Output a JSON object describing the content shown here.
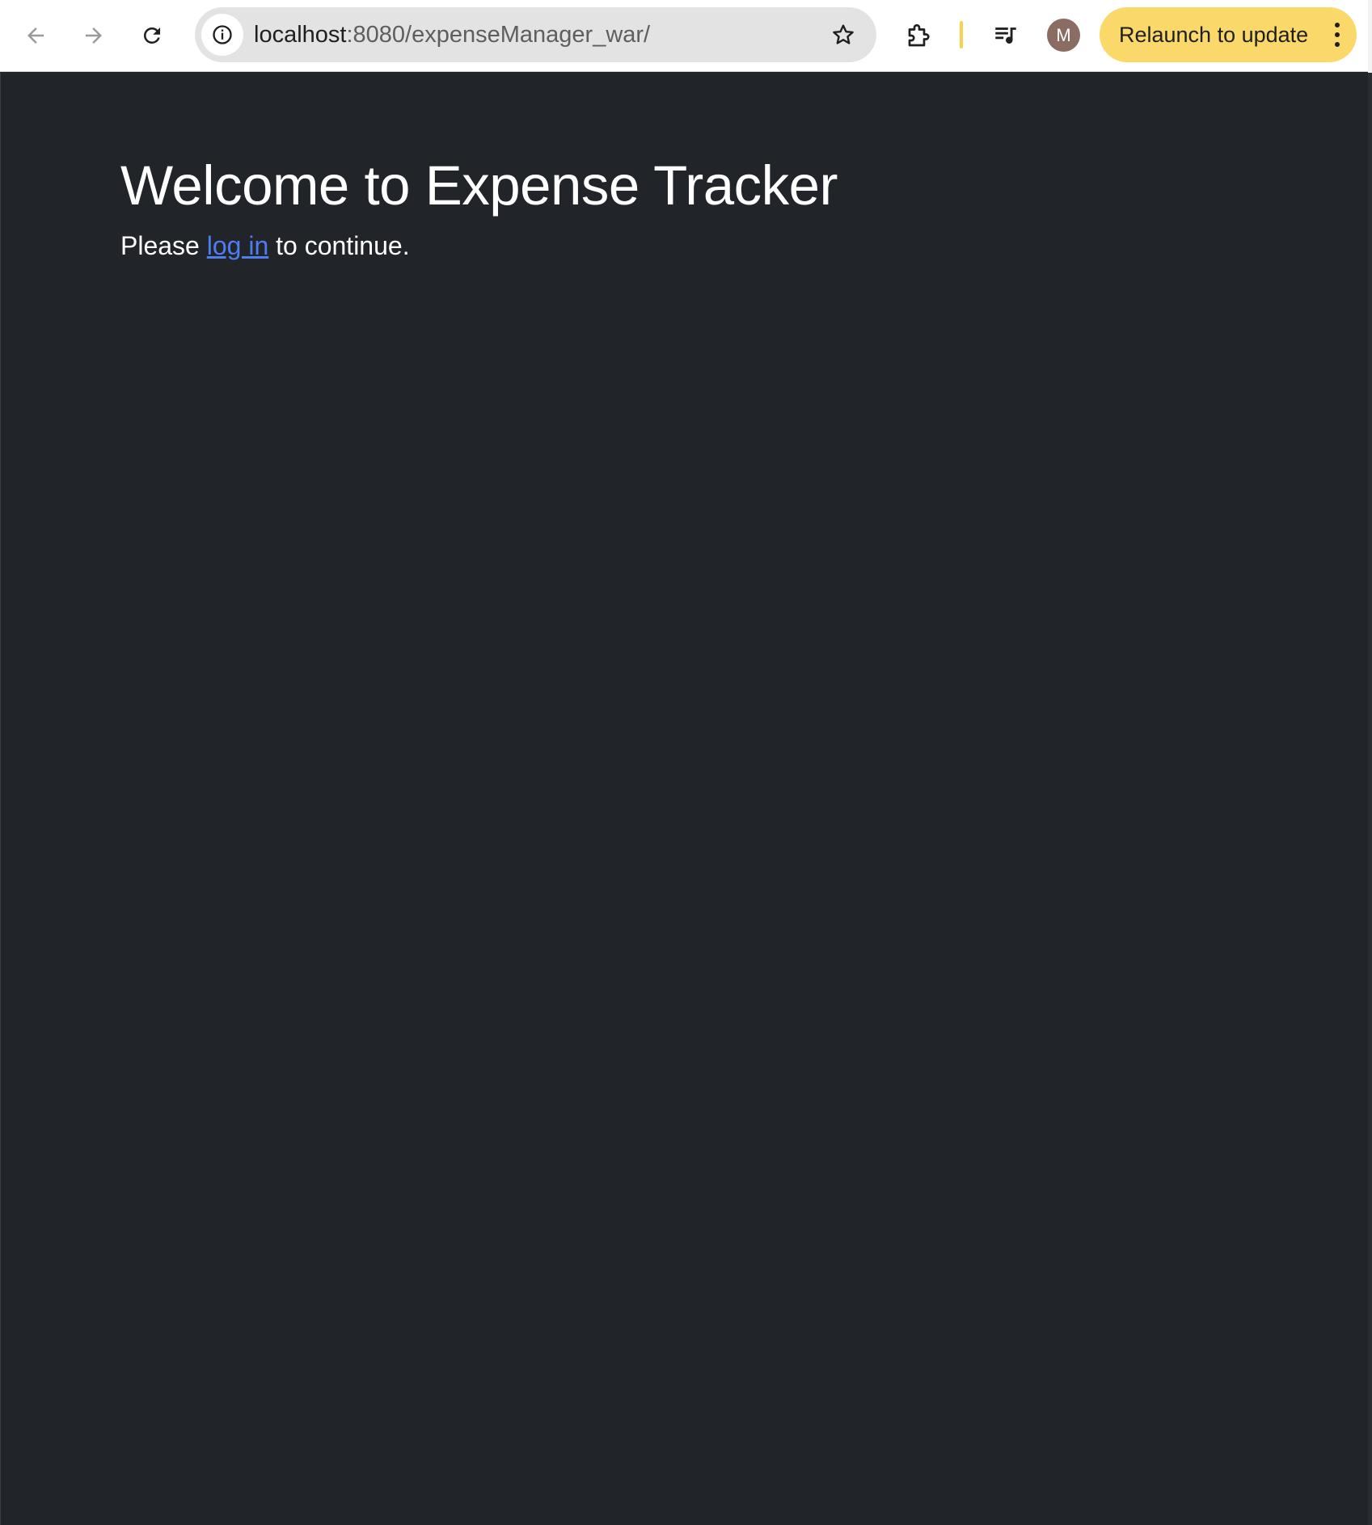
{
  "browser": {
    "url_host": "localhost",
    "url_path": ":8080/expenseManager_war/",
    "avatar_initial": "M",
    "relaunch_label": "Relaunch to update",
    "icons": {
      "back": "arrow-left-icon",
      "forward": "arrow-right-icon",
      "reload": "reload-icon",
      "site_info": "info-icon",
      "bookmark": "star-icon",
      "extensions": "puzzle-icon",
      "media": "media-queue-icon",
      "menu": "kebab-menu-icon"
    },
    "colors": {
      "relaunch_bg": "#fad96a",
      "avatar_bg": "#8a6c62",
      "page_bg": "#212428",
      "link": "#4e7df0"
    }
  },
  "page": {
    "heading": "Welcome to Expense Tracker",
    "message_prefix": "Please ",
    "login_link": "log in",
    "message_suffix": " to continue."
  }
}
